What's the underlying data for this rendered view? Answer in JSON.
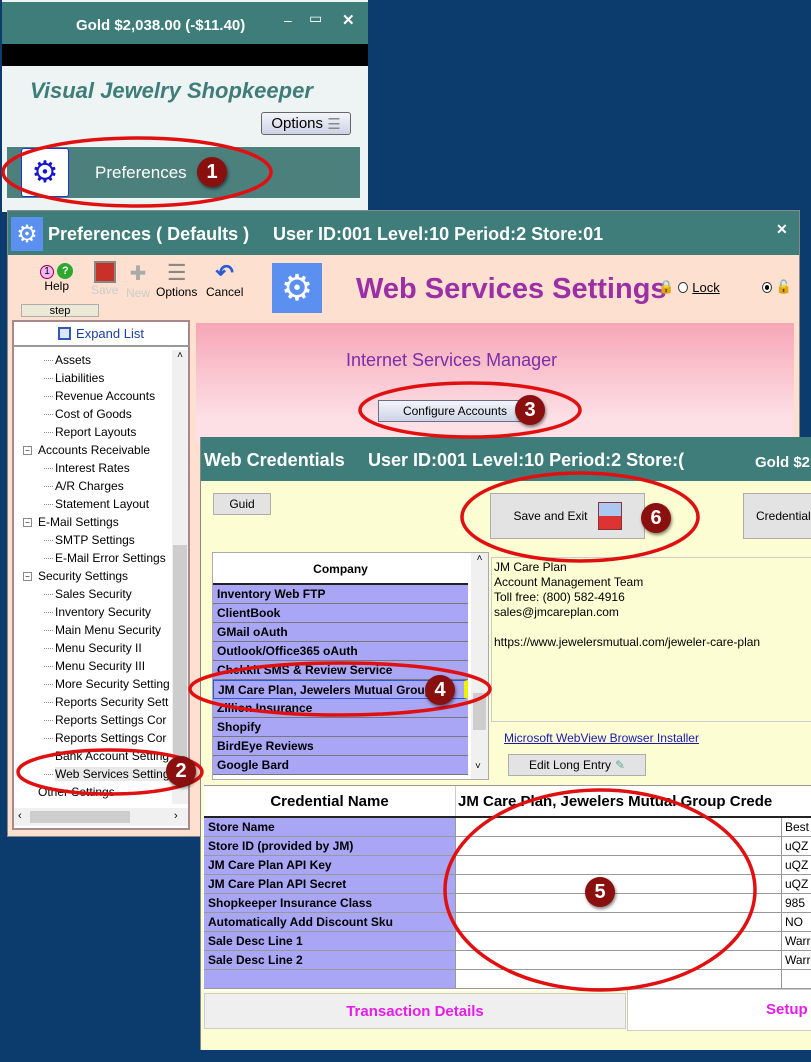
{
  "main_window": {
    "title": "Gold $2,038.00 (-$11.40)",
    "app_name": "Visual Jewelry Shopkeeper",
    "options_label": "Options",
    "preferences_label": "Preferences"
  },
  "prefs_window": {
    "title": "Preferences ( Defaults )",
    "user_info": "User ID:001 Level:10 Period:2 Store:01",
    "toolbar": {
      "help_badge": "1",
      "help": "Help",
      "save": "Save",
      "new": "New",
      "options": "Options",
      "cancel": "Cancel",
      "step": "step"
    },
    "heading": "Web Services Settings",
    "lock_label": "Lock",
    "expand_list": "Expand List",
    "tree": [
      {
        "label": "Assets",
        "level": 2
      },
      {
        "label": "Liabilities",
        "level": 2
      },
      {
        "label": "Revenue Accounts",
        "level": 2
      },
      {
        "label": "Cost of Goods",
        "level": 2
      },
      {
        "label": "Report Layouts",
        "level": 2
      },
      {
        "label": "Accounts Receivable",
        "level": 1
      },
      {
        "label": "Interest Rates",
        "level": 2
      },
      {
        "label": "A/R Charges",
        "level": 2
      },
      {
        "label": "Statement Layout",
        "level": 2
      },
      {
        "label": "E-Mail Settings",
        "level": 1
      },
      {
        "label": "SMTP Settings",
        "level": 2
      },
      {
        "label": "E-Mail Error Settings",
        "level": 2
      },
      {
        "label": "Security Settings",
        "level": 1
      },
      {
        "label": "Sales Security",
        "level": 2
      },
      {
        "label": "Inventory Security",
        "level": 2
      },
      {
        "label": "Main Menu Security",
        "level": 2
      },
      {
        "label": "Menu Security II",
        "level": 2
      },
      {
        "label": "Menu Security III",
        "level": 2
      },
      {
        "label": "More Security Setting",
        "level": 2
      },
      {
        "label": "Reports Security Sett",
        "level": 2
      },
      {
        "label": "Reports Settings Cor",
        "level": 2
      },
      {
        "label": "Reports Settings Cor",
        "level": 2
      },
      {
        "label": "Bank Account Setting",
        "level": 2
      },
      {
        "label": "Web Services Setting",
        "level": 2,
        "selected": true
      },
      {
        "label": "Other Settings",
        "level": 1
      }
    ],
    "services_manager": "Internet Services Manager",
    "configure_accounts": "Configure Accounts"
  },
  "cred_window": {
    "title": "Web Credentials",
    "user_info": "User ID:001 Level:10 Period:2 Store:(",
    "gold": "Gold $2",
    "guid": "Guid",
    "save_exit": "Save and Exit",
    "credential_btn": "Credential",
    "company_header": "Company",
    "companies": [
      "Inventory Web FTP",
      "ClientBook",
      "GMail oAuth",
      "Outlook/Office365 oAuth",
      "Chekkit SMS & Review Service",
      "JM Care Plan, Jewelers Mutual Group",
      "Zillion Insurance",
      "Shopify",
      "BirdEye Reviews",
      "Google Bard"
    ],
    "selected_company": "JM Care Plan, Jewelers Mutual Group",
    "info_lines": [
      "JM Care Plan",
      "Account Management Team",
      "Toll free:  (800) 582-4916",
      "sales@jmcareplan.com",
      "",
      "https://www.jewelersmutual.com/jeweler-care-plan"
    ],
    "webview_link": "Microsoft WebView Browser Installer",
    "edit_long_entry": "Edit Long Entry",
    "grid_header": {
      "name": "Credential Name",
      "value": "JM Care Plan, Jewelers Mutual Group Crede"
    },
    "grid_rows": [
      {
        "name": "Store Name",
        "value": "Best"
      },
      {
        "name": "Store ID (provided by JM)",
        "value": "uQZ"
      },
      {
        "name": "JM Care Plan API Key",
        "value": "uQZ"
      },
      {
        "name": "JM Care Plan API Secret",
        "value": "uQZ"
      },
      {
        "name": "Shopkeeper Insurance Class",
        "value": "985"
      },
      {
        "name": "Automatically Add Discount Sku",
        "value": "NO"
      },
      {
        "name": "Sale Desc Line 1",
        "value": "Warr"
      },
      {
        "name": "Sale Desc Line 2",
        "value": "Warr"
      },
      {
        "name": "",
        "value": ""
      }
    ],
    "tabs": [
      "Transaction Details",
      "Setup"
    ]
  },
  "annotations": [
    "1",
    "2",
    "3",
    "4",
    "5",
    "6"
  ],
  "colors": {
    "titlebar": "#3e7d7a",
    "annotation": "#e01010",
    "badge": "#8a0f0f",
    "heading": "#9b2fa6",
    "tab_text": "#e81ce8",
    "company_bg": "#aaa6f6"
  }
}
